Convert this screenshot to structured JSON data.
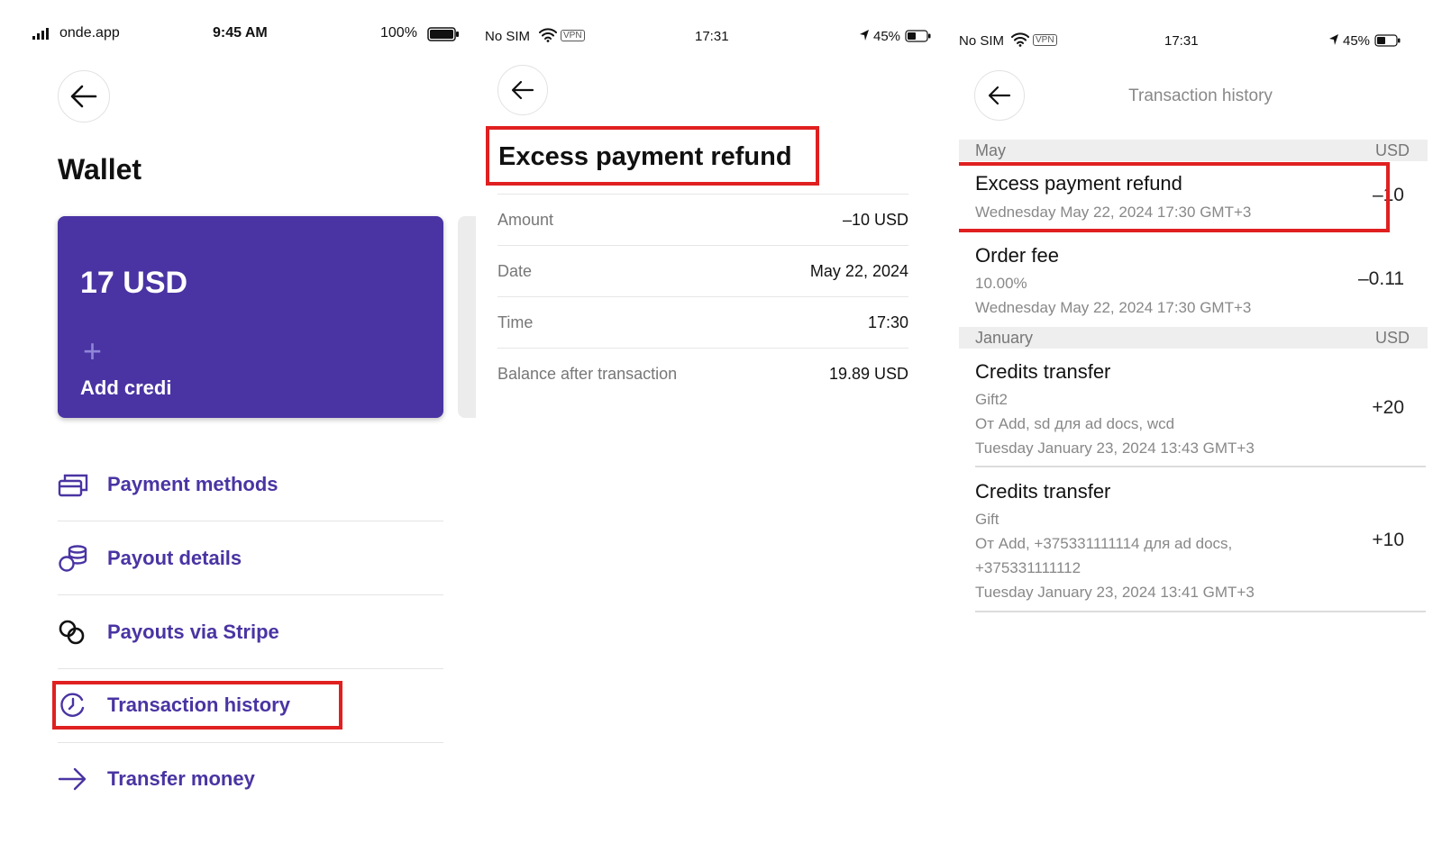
{
  "screen1": {
    "status": {
      "carrier": "onde.app",
      "time": "9:45 AM",
      "battery": "100%"
    },
    "title": "Wallet",
    "card": {
      "balance": "17 USD",
      "add_label": "Add credi"
    },
    "menu": [
      {
        "label": "Payment methods",
        "icon": "cards-icon"
      },
      {
        "label": "Payout details",
        "icon": "coins-icon"
      },
      {
        "label": "Payouts via Stripe",
        "icon": "rings-icon"
      },
      {
        "label": "Transaction history",
        "icon": "history-icon"
      },
      {
        "label": "Transfer money",
        "icon": "arrow-right-icon"
      }
    ],
    "accent": "#4a34a3"
  },
  "screen2": {
    "status": {
      "carrier": "No SIM",
      "vpn": "VPN",
      "time": "17:31",
      "battery": "45%"
    },
    "title": "Excess payment refund",
    "rows": [
      {
        "label": "Amount",
        "value": "–10 USD"
      },
      {
        "label": "Date",
        "value": "May 22, 2024"
      },
      {
        "label": "Time",
        "value": "17:30"
      },
      {
        "label": "Balance after transaction",
        "value": "19.89 USD"
      }
    ]
  },
  "screen3": {
    "status": {
      "carrier": "No SIM",
      "vpn": "VPN",
      "time": "17:31",
      "battery": "45%"
    },
    "header": "Transaction history",
    "sections": [
      {
        "name": "May",
        "currency": "USD",
        "items": [
          {
            "title": "Excess payment refund",
            "lines": [
              "Wednesday May 22, 2024 17:30 GMT+3"
            ],
            "amount": "–10"
          },
          {
            "title": "Order fee",
            "lines": [
              "10.00%",
              "Wednesday May 22, 2024 17:30 GMT+3"
            ],
            "amount": "–0.11"
          }
        ]
      },
      {
        "name": "January",
        "currency": "USD",
        "items": [
          {
            "title": "Credits transfer",
            "lines": [
              "Gift2",
              "От Add, sd  для ad docs, wcd",
              "Tuesday January 23, 2024 13:43 GMT+3"
            ],
            "amount": "+20"
          },
          {
            "title": "Credits transfer",
            "lines": [
              "Gift",
              "От Add, +375331111114 для ad docs,",
              "+375331111112",
              "Tuesday January 23, 2024 13:41 GMT+3"
            ],
            "amount": "+10"
          }
        ]
      }
    ]
  },
  "highlight_color": "#e02020"
}
